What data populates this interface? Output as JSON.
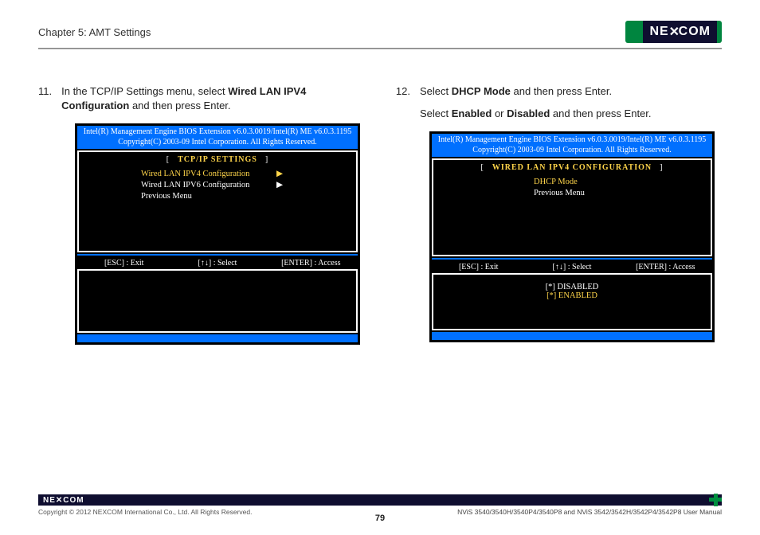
{
  "header": {
    "chapter": "Chapter 5: AMT Settings",
    "logo_text": "NE COM",
    "logo_x": "✕"
  },
  "left": {
    "step_num": "11.",
    "step_text_1": "In the TCP/IP Settings menu, select ",
    "step_bold_1": "Wired LAN IPV4 Configuration",
    "step_text_2": " and then press Enter.",
    "bios": {
      "hdr_line1": "Intel(R) Management Engine BIOS Extension v6.0.3.0019/Intel(R) ME v6.0.3.1195",
      "hdr_line2": "Copyright(C) 2003-09 Intel Corporation. All Rights Reserved.",
      "title": "TCP/IP SETTINGS",
      "items": [
        {
          "label": "Wired LAN IPV4 Configuration",
          "sel": true,
          "arrow": "▶"
        },
        {
          "label": "Wired LAN IPV6 Configuration",
          "sel": false,
          "arrow": "▶"
        },
        {
          "label": "Previous Menu",
          "sel": false,
          "arrow": ""
        }
      ],
      "hints": {
        "esc": "[ESC] : Exit",
        "sel": "[↑↓] : Select",
        "enter": "[ENTER] : Access"
      }
    }
  },
  "right": {
    "step_num": "12.",
    "step_a_1": "Select ",
    "step_a_b": "DHCP Mode",
    "step_a_2": " and then press Enter.",
    "step_b_1": "Select ",
    "step_b_b1": "Enabled",
    "step_b_mid": " or ",
    "step_b_b2": "Disabled",
    "step_b_2": " and then press Enter.",
    "bios": {
      "hdr_line1": "Intel(R) Management Engine BIOS Extension v6.0.3.0019/Intel(R) ME v6.0.3.1195",
      "hdr_line2": "Copyright(C) 2003-09 Intel Corporation. All Rights Reserved.",
      "title": "WIRED LAN IPV4 CONFIGURATION",
      "items": [
        {
          "label": "DHCP Mode",
          "sel": true
        },
        {
          "label": "Previous Menu",
          "sel": false
        }
      ],
      "hints": {
        "esc": "[ESC] : Exit",
        "sel": "[↑↓] : Select",
        "enter": "[ENTER] : Access"
      },
      "opts": [
        {
          "label": "[*] DISABLED",
          "sel": false
        },
        {
          "label": "[*] ENABLED",
          "sel": true
        }
      ]
    }
  },
  "footer": {
    "logo": "NE✕COM",
    "copyright": "Copyright © 2012 NEXCOM International Co., Ltd. All Rights Reserved.",
    "page": "79",
    "pub": "NViS 3540/3540H/3540P4/3540P8 and NViS 3542/3542H/3542P4/3542P8 User Manual"
  }
}
